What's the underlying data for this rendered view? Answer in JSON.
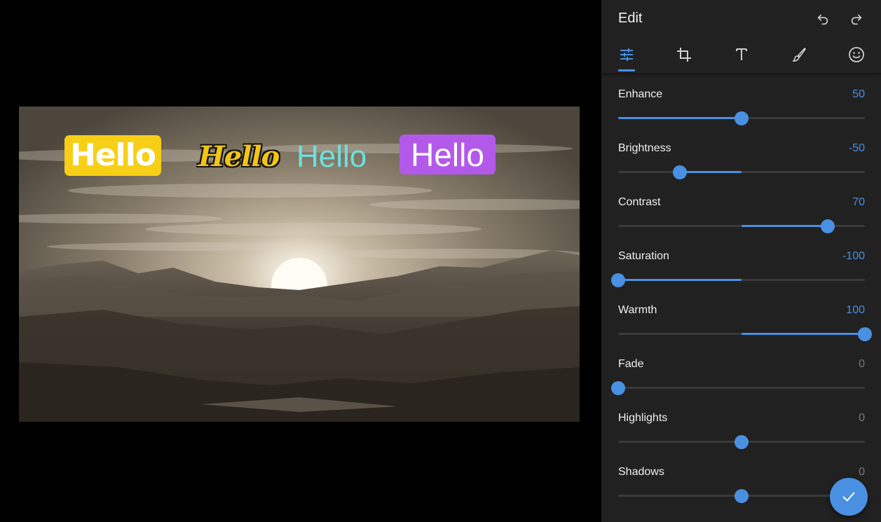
{
  "header": {
    "title": "Edit"
  },
  "icons": {
    "undo": "undo-icon",
    "redo": "redo-icon",
    "tabs": [
      "sliders-icon",
      "crop-icon",
      "text-icon",
      "brush-icon",
      "smiley-icon"
    ],
    "confirm": "check-icon"
  },
  "colors": {
    "accent": "#4a90e2",
    "panel_bg": "#212121",
    "canvas_bg": "#000000",
    "track": "#3a3a3a",
    "zero_value": "#7a7a7a"
  },
  "stickers": [
    {
      "text": "Hello",
      "style": "yellow-badge-bold",
      "color": "#f7cf16"
    },
    {
      "text": "Hello",
      "style": "script-yellow-outlined",
      "color": "#f3c417"
    },
    {
      "text": "Hello",
      "style": "plain-cyan",
      "color": "#6ce0df"
    },
    {
      "text": "Hello",
      "style": "purple-badge",
      "color": "#b359ea"
    }
  ],
  "adjustments": [
    {
      "label": "Enhance",
      "value": "50",
      "min": 0,
      "max": 100,
      "level": 50,
      "origin": 0
    },
    {
      "label": "Brightness",
      "value": "-50",
      "min": -100,
      "max": 100,
      "level": -50,
      "origin": 0
    },
    {
      "label": "Contrast",
      "value": "70",
      "min": -100,
      "max": 100,
      "level": 70,
      "origin": 0
    },
    {
      "label": "Saturation",
      "value": "-100",
      "min": -100,
      "max": 100,
      "level": -100,
      "origin": 0
    },
    {
      "label": "Warmth",
      "value": "100",
      "min": -100,
      "max": 100,
      "level": 100,
      "origin": 0
    },
    {
      "label": "Fade",
      "value": "0",
      "min": 0,
      "max": 100,
      "level": 0,
      "origin": 0
    },
    {
      "label": "Highlights",
      "value": "0",
      "min": -100,
      "max": 100,
      "level": 0,
      "origin": 0
    },
    {
      "label": "Shadows",
      "value": "0",
      "min": -100,
      "max": 100,
      "level": 0,
      "origin": 0
    }
  ]
}
